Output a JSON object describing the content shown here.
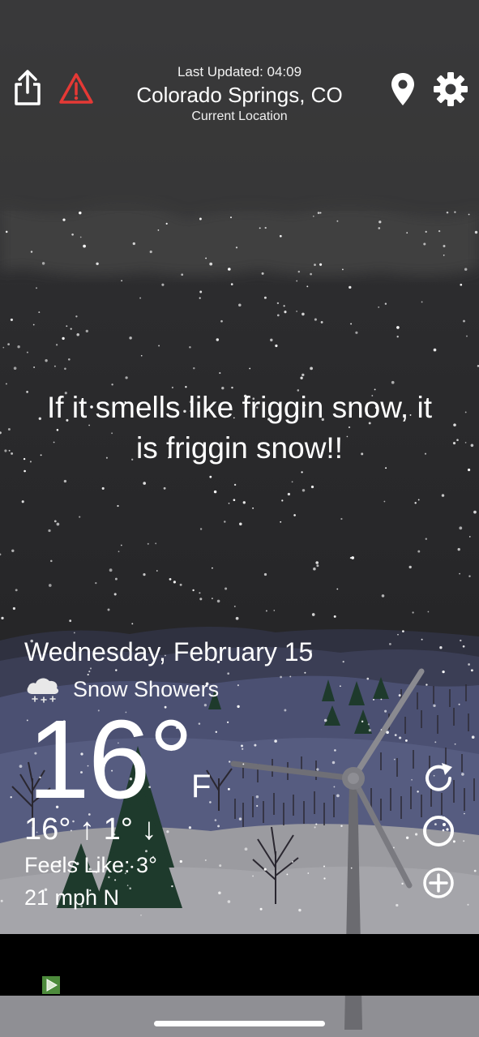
{
  "header": {
    "last_updated": "Last Updated: 04:09",
    "location": "Colorado Springs, CO",
    "location_sub": "Current Location"
  },
  "quote": {
    "line1": "If it smells like friggin snow, it",
    "line2": "is friggin snow!!"
  },
  "weather": {
    "date": "Wednesday, February 15",
    "condition": "Snow Showers",
    "condition_icon": "snow-cloud-icon",
    "temperature": "16°",
    "unit": "F",
    "high_low": "16° ↑ 1° ↓",
    "feels_like": "Feels Like: 3°",
    "wind": "21 mph N"
  },
  "icons": {
    "share": "share-icon",
    "alert": "alert-triangle-icon",
    "location_pin": "location-pin-icon",
    "settings": "gear-icon",
    "refresh": "refresh-icon",
    "radar": "radar-icon",
    "add": "add-location-icon"
  },
  "colors": {
    "alert": "#e53935",
    "sky_top": "#3a3a3c",
    "sky_night": "#1e1e20",
    "hills": "#4a4f6e",
    "snow_ground": "#9a9aa0"
  }
}
